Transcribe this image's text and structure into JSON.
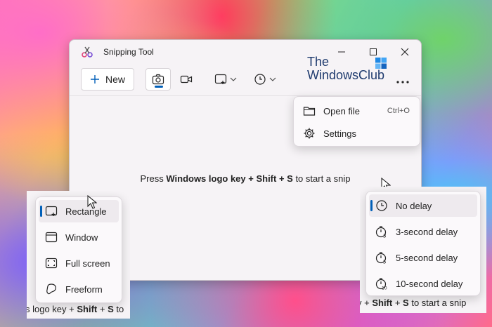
{
  "window": {
    "title": "Snipping Tool",
    "new_label": "New",
    "hint": {
      "before": "Press ",
      "bold1": "Windows logo key + Shift + S",
      "after": " to start a snip"
    }
  },
  "watermark": {
    "line1": "The",
    "line2": "WindowsClub"
  },
  "more_menu": {
    "items": [
      {
        "label": "Open file",
        "shortcut": "Ctrl+O",
        "icon": "folder-icon"
      },
      {
        "label": "Settings",
        "shortcut": "",
        "icon": "gear-icon"
      }
    ]
  },
  "shape_menu": {
    "selected": "Rectangle",
    "items": [
      {
        "label": "Rectangle",
        "icon": "rectangle-snip-icon"
      },
      {
        "label": "Window",
        "icon": "window-snip-icon"
      },
      {
        "label": "Full screen",
        "icon": "fullscreen-snip-icon"
      },
      {
        "label": "Freeform",
        "icon": "freeform-snip-icon"
      }
    ],
    "footer": {
      "before": "s logo key + ",
      "bold1": "Shift",
      "mid": " + ",
      "bold2": "S",
      "after": " to"
    }
  },
  "delay_menu": {
    "selected": "No delay",
    "items": [
      {
        "label": "No delay",
        "icon": "clock-icon"
      },
      {
        "label": "3-second delay",
        "icon": "timer-3-icon"
      },
      {
        "label": "5-second delay",
        "icon": "timer-5-icon"
      },
      {
        "label": "10-second delay",
        "icon": "timer-10-icon"
      }
    ],
    "footer": {
      "before": "y + ",
      "bold1": "Shift",
      "mid": " + ",
      "bold2": "S",
      "after": " to start a snip"
    }
  },
  "colors": {
    "accent": "#005fb8",
    "window_bg": "#f6f3f6"
  }
}
